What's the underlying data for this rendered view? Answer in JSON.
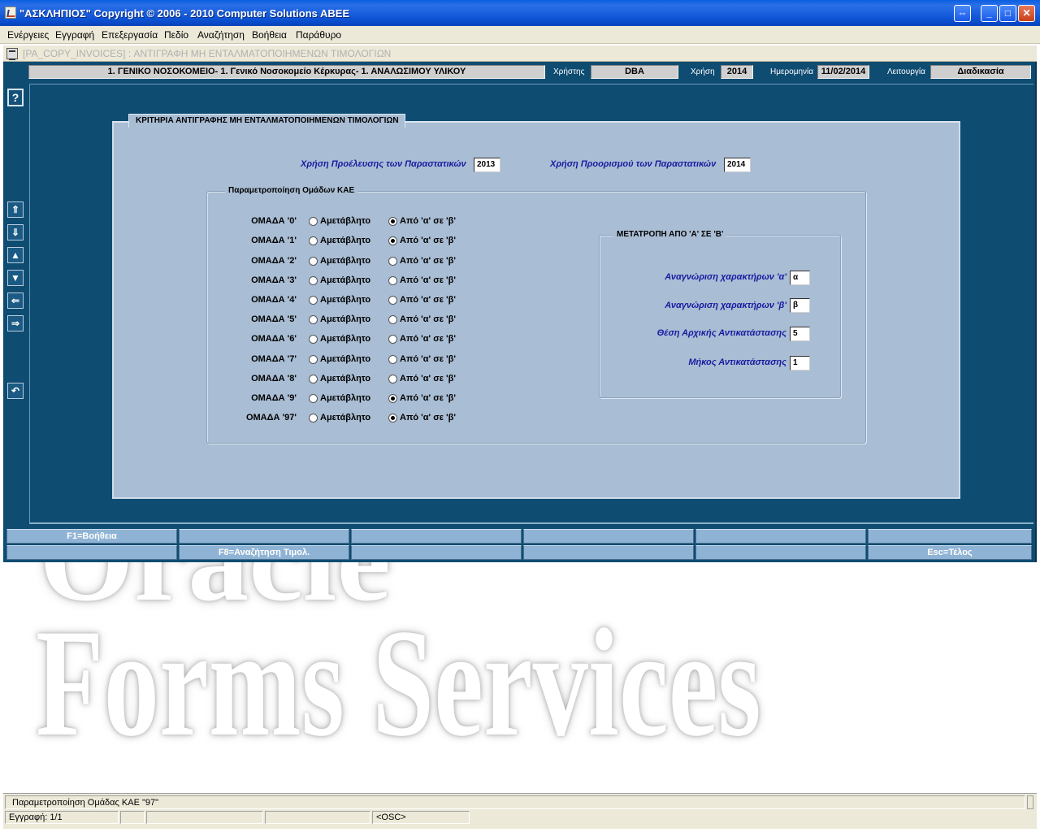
{
  "window": {
    "title": "\"ΑΣΚΛΗΠΙΟΣ\" Copyright © 2006 - 2010 Computer Solutions ABEE",
    "restore_btn": "⇔",
    "min_btn": "_",
    "max_btn": "□",
    "close_btn": "✕"
  },
  "menu": [
    "Ενέργειες",
    "Εγγραφή",
    "Επεξεργασία",
    "Πεδίο",
    "Αναζήτηση",
    "Βοήθεια",
    "Παράθυρο"
  ],
  "form": {
    "caption": "[PA_COPY_INVOICES]  :  ΑΝΤΙΓΡΑΦΗ ΜΗ ΕΝΤΑΛΜΑΤΟΠΟΙΗΜΕΝΩΝ ΤΙΜΟΛΟΓΙΩΝ"
  },
  "header": {
    "organization": "1. ΓΕΝΙΚΟ ΝΟΣΟΚΟΜΕΙΟ- 1. Γενικό Νοσοκομείο Κέρκυρας- 1. ΑΝΑΛΩΣΙΜΟΥ ΥΛΙΚΟΥ",
    "user_label": "Χρήστης",
    "user_value": "DBA",
    "year_label": "Χρήση",
    "year_value": "2014",
    "date_label": "Ημερομηνία",
    "date_value": "11/02/2014",
    "mode_label": "Λειτουργία",
    "mode_value": "Διαδικασία"
  },
  "side_buttons": {
    "help": "?",
    "first": "⇑",
    "last": "⇓",
    "prev": "▲",
    "next": "▼",
    "back": "⇐",
    "forward": "⇒",
    "undo": "↶"
  },
  "panel": {
    "title": "ΚΡΙΤΗΡΙΑ ΑΝΤΙΓΡΑΦΗΣ ΜΗ ΕΝΤΑΛΜΑΤΟΠΟΙΗΜΕΝΩΝ ΤΙΜΟΛΟΓΙΩΝ",
    "source_year_label": "Χρήση Προέλευσης των Παραστατικών",
    "source_year_value": "2013",
    "target_year_label": "Χρήση Προορισμού των Παραστατικών",
    "target_year_value": "2014"
  },
  "groups": {
    "title": "Παραμετροποίηση Ομάδων ΚΑΕ",
    "option_unchanged": "Αμετάβλητο",
    "option_convert": "Από 'α' σε 'β'",
    "items": [
      {
        "label": "ΟΜΑΔΑ '0'",
        "selected": "convert"
      },
      {
        "label": "ΟΜΑΔΑ '1'",
        "selected": "convert"
      },
      {
        "label": "ΟΜΑΔΑ '2'",
        "selected": "none"
      },
      {
        "label": "ΟΜΑΔΑ '3'",
        "selected": "none"
      },
      {
        "label": "ΟΜΑΔΑ '4'",
        "selected": "none"
      },
      {
        "label": "ΟΜΑΔΑ '5'",
        "selected": "none"
      },
      {
        "label": "ΟΜΑΔΑ '6'",
        "selected": "none"
      },
      {
        "label": "ΟΜΑΔΑ '7'",
        "selected": "none"
      },
      {
        "label": "ΟΜΑΔΑ '8'",
        "selected": "none"
      },
      {
        "label": "ΟΜΑΔΑ '9'",
        "selected": "convert"
      },
      {
        "label": "ΟΜΑΔΑ '97'",
        "selected": "convert"
      }
    ]
  },
  "conversion": {
    "title": "ΜΕΤΑΤΡΟΠΗ ΑΠΟ 'Α' ΣΕ 'Β'",
    "char_a_label": "Αναγνώριση χαρακτήρων 'α'",
    "char_a_value": "α",
    "char_b_label": "Αναγνώριση χαρακτήρων 'β'",
    "char_b_value": "β",
    "start_pos_label": "Θέση Αρχικής Αντικατάστασης",
    "start_pos_value": "5",
    "length_label": "Μήκος Αντικατάστασης",
    "length_value": "1"
  },
  "function_keys": {
    "f1": "F1=Βοήθεια",
    "f8": "F8=Αναζήτηση Τιμολ.",
    "esc": "Esc=Τέλος"
  },
  "watermark": {
    "line1": "Oracle",
    "line2": "Forms Services"
  },
  "status": {
    "message": "Παραμετροποίηση Ομάδας ΚΑΕ \"97\"",
    "record": "Εγγραφή: 1/1",
    "mode": "<OSC>"
  }
}
